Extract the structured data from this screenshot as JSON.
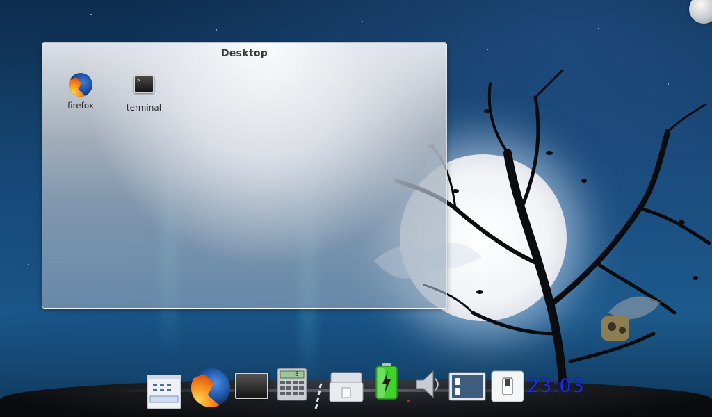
{
  "desktop_panel": {
    "title": "Desktop",
    "icons": [
      {
        "label": "firefox",
        "icon": "firefox-icon"
      },
      {
        "label": "terminal",
        "icon": "terminal-icon"
      }
    ]
  },
  "dock": {
    "items": [
      {
        "name": "file-manager",
        "icon": "file-manager-icon"
      },
      {
        "name": "firefox",
        "icon": "firefox-icon"
      },
      {
        "name": "terminal",
        "icon": "terminal-icon"
      },
      {
        "name": "calculator",
        "icon": "calculator-icon"
      },
      {
        "name": "separator",
        "icon": "separator-icon"
      },
      {
        "name": "trash",
        "icon": "trash-icon"
      },
      {
        "name": "battery",
        "icon": "battery-icon"
      },
      {
        "name": "volume",
        "icon": "speaker-icon"
      },
      {
        "name": "show-desktop",
        "icon": "desktop-switcher-icon"
      },
      {
        "name": "toggle-switch",
        "icon": "switch-icon"
      }
    ],
    "calculator_display": "8",
    "clock": "23:03"
  },
  "colors": {
    "clock": "#1b2bff",
    "battery": "#3fd22a"
  }
}
